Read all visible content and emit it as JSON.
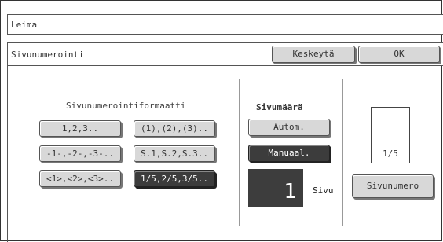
{
  "window": {
    "title": "Leima"
  },
  "header": {
    "title": "Sivunumerointi",
    "cancel_label": "Keskeytä",
    "ok_label": "OK"
  },
  "format": {
    "heading": "Sivunumerointiformaatti",
    "options": [
      {
        "label": "1,2,3.."
      },
      {
        "label": "(1),(2),(3).."
      },
      {
        "label": "-1-,-2-,-3-.."
      },
      {
        "label": "S.1,S.2,S.3.."
      },
      {
        "label": "<1>,<2>,<3>.."
      },
      {
        "label": "1/5,2/5,3/5.."
      }
    ],
    "selected": "1/5,2/5,3/5.."
  },
  "count": {
    "heading": "Sivumäärä",
    "auto_label": "Autom.",
    "manual_label": "Manuaal.",
    "selected": "Manuaal.",
    "value": "1",
    "unit": "Sivu"
  },
  "preview": {
    "text": "1/5",
    "button_label": "Sivunumero"
  }
}
